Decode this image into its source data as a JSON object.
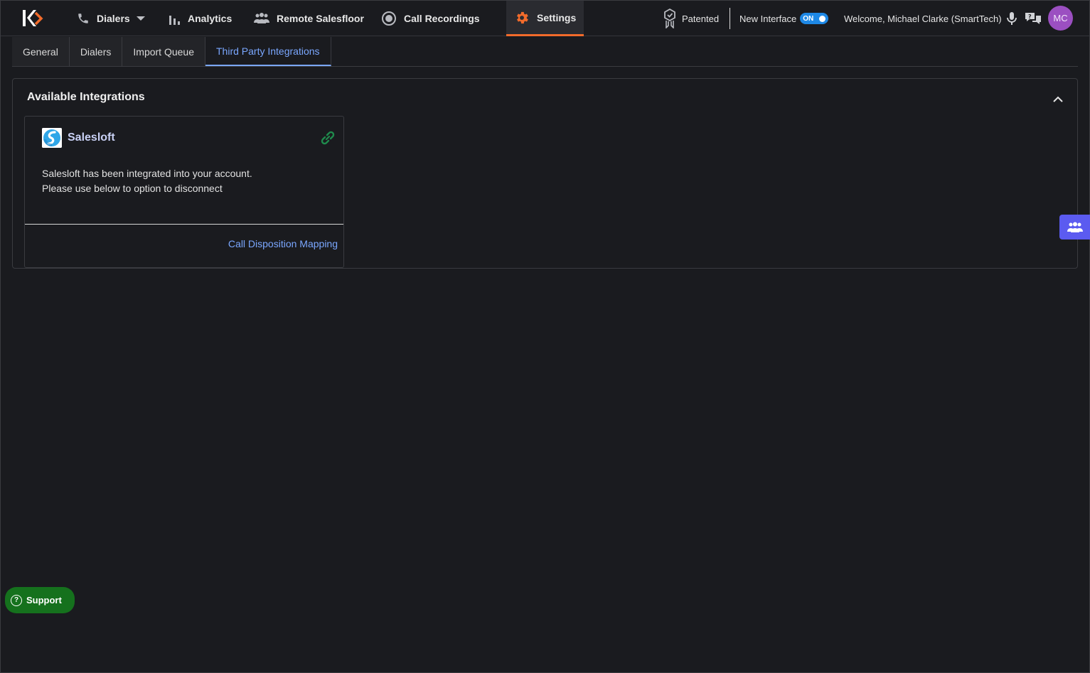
{
  "nav": {
    "dialers": "Dialers",
    "analytics": "Analytics",
    "remote_salesfloor": "Remote Salesfloor",
    "call_recordings": "Call Recordings",
    "settings": "Settings"
  },
  "header_right": {
    "patented": "Patented",
    "new_interface": "New Interface",
    "toggle_state": "ON",
    "welcome": "Welcome, Michael Clarke (SmartTech)",
    "avatar_initials": "MC"
  },
  "tabs": [
    "General",
    "Dialers",
    "Import Queue",
    "Third Party Integrations"
  ],
  "panel": {
    "title": "Available Integrations",
    "card": {
      "name": "Salesloft",
      "description_line1": "Salesloft has been integrated into your account.",
      "description_line2": "Please use below to option to disconnect",
      "footer_link": "Call Disposition Mapping"
    }
  },
  "support": {
    "label": "Support"
  },
  "colors": {
    "accent": "#f26b2b",
    "link": "#7aa7ff",
    "support_green": "#15711d",
    "toggle_blue": "#1e88e5",
    "avatar_purple": "#9b4fc1",
    "team_button": "#5b5bf0"
  }
}
